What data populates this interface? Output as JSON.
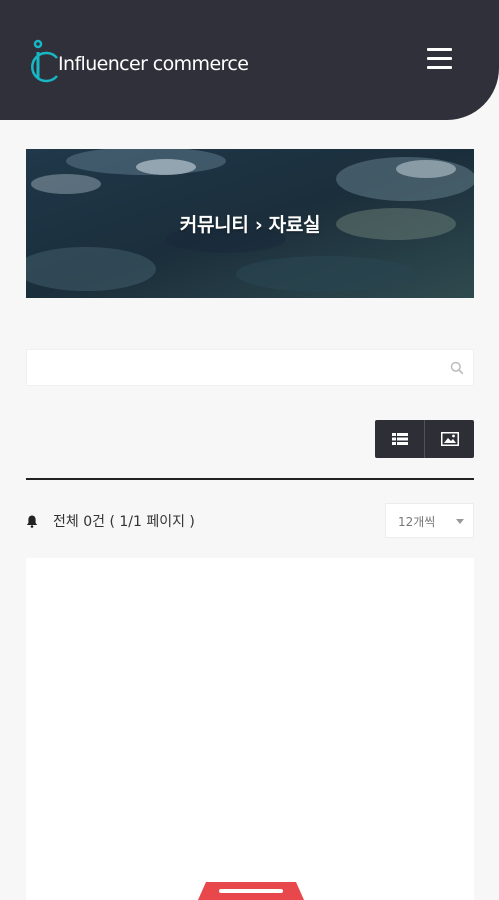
{
  "header": {
    "logo_text": "Influencer commerce",
    "menu_icon": "hamburger-menu-icon"
  },
  "banner": {
    "title": "커뮤니티  ›  자료실"
  },
  "search": {
    "value": "",
    "placeholder": "",
    "icon": "search-icon"
  },
  "view_toggle": {
    "list_icon": "list-view-icon",
    "gallery_icon": "gallery-view-icon"
  },
  "summary": {
    "total_text": "전체 0건 ( 1/1 페이지 )"
  },
  "page_size": {
    "selected": "12개씩"
  },
  "colors": {
    "header_bg": "#30303a",
    "accent_teal": "#17b7c4",
    "empty_icon_red": "#e8474b"
  }
}
